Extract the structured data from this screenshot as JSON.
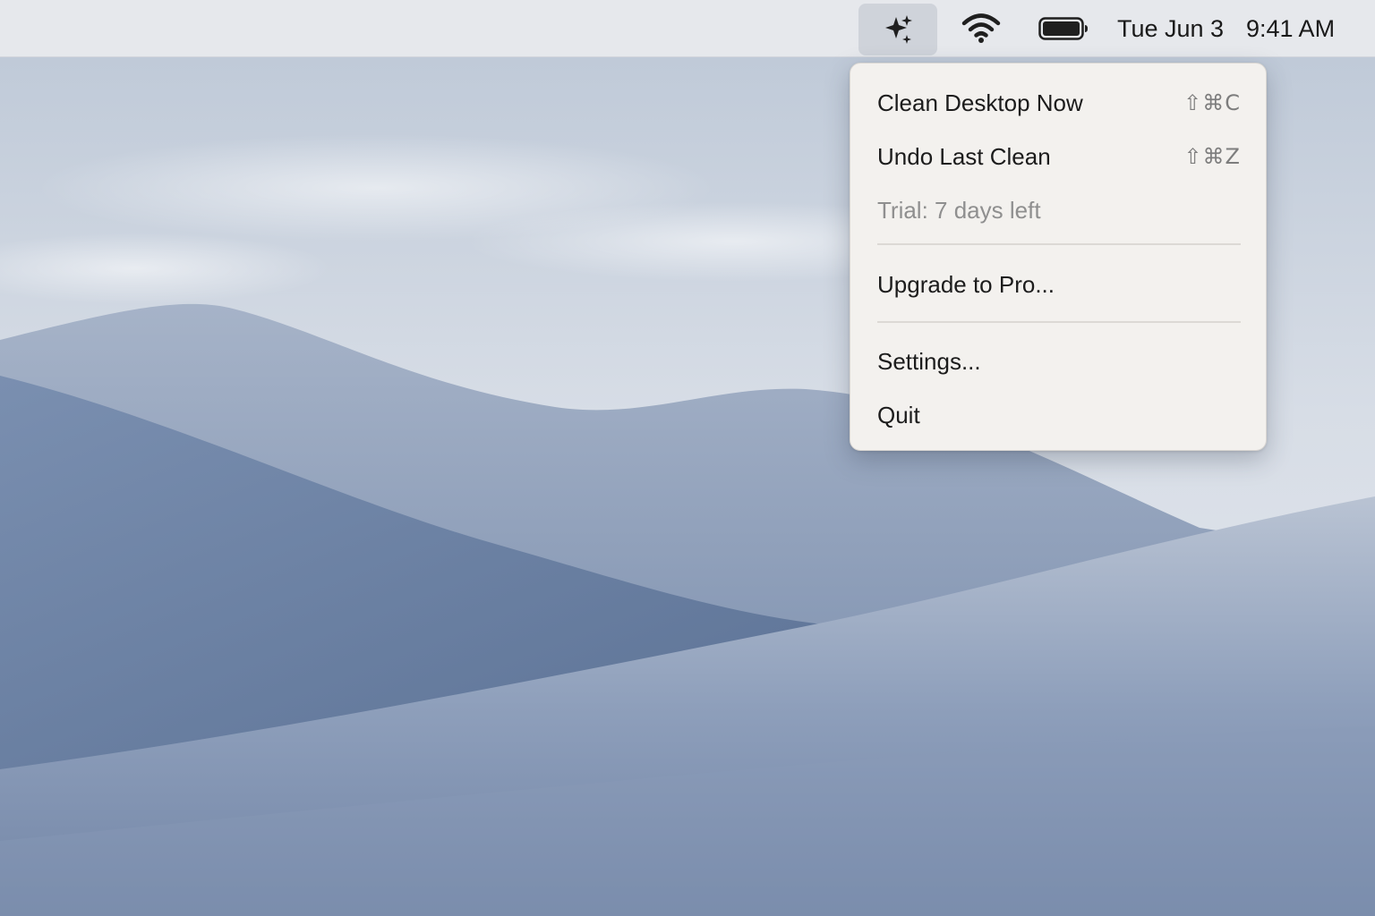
{
  "menubar": {
    "status_icons": {
      "app_icon": "sparkles-icon",
      "wifi_icon": "wifi-icon",
      "battery_icon": "battery-icon"
    },
    "clock": {
      "date": "Tue Jun 3",
      "time": "9:41 AM"
    }
  },
  "menu": {
    "items": [
      {
        "label": "Clean Desktop Now",
        "shortcut": "⇧⌘C"
      },
      {
        "label": "Undo Last Clean",
        "shortcut": "⇧⌘Z"
      },
      {
        "label": "Trial: 7 days left"
      },
      {
        "label": "Upgrade to Pro..."
      },
      {
        "label": "Settings..."
      },
      {
        "label": "Quit"
      }
    ]
  },
  "colors": {
    "menubar_bg": "#e6e8ec",
    "menu_bg": "#f3f1ee",
    "text": "#1c1c1c",
    "disabled_text": "#8f8f8f",
    "dune_blue": "#6f84a6"
  }
}
